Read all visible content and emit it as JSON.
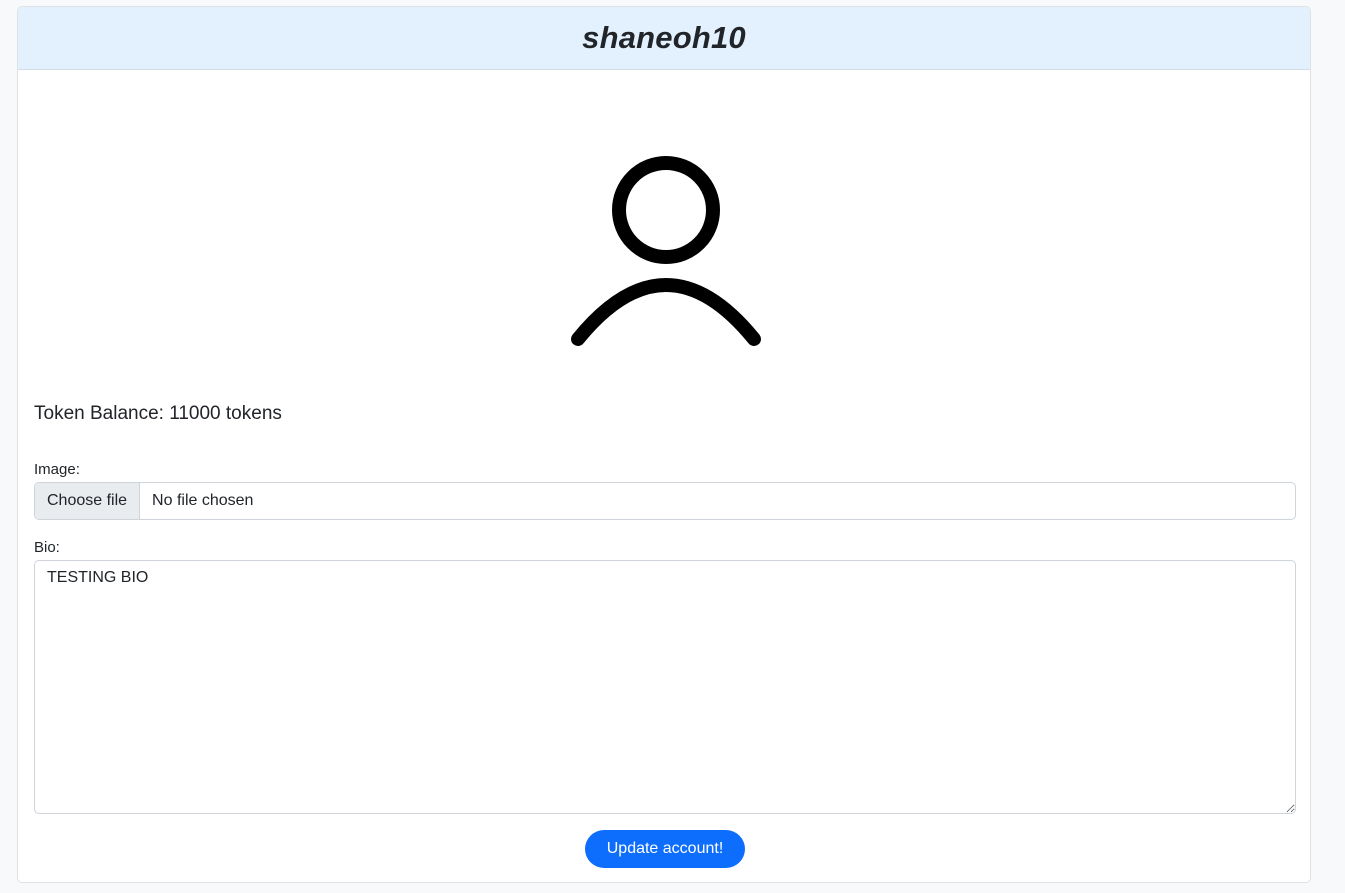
{
  "profile": {
    "username": "shaneoh10",
    "avatar_icon": "user-outline-icon",
    "token_balance_text": "Token Balance: 11000 tokens"
  },
  "form": {
    "image_label": "Image:",
    "file_button_label": "Choose file",
    "file_status": "No file chosen",
    "bio_label": "Bio:",
    "bio_value": "TESTING BIO",
    "submit_label": "Update account!"
  },
  "colors": {
    "header_bg": "#e3f0fd",
    "primary": "#0d6efd"
  }
}
